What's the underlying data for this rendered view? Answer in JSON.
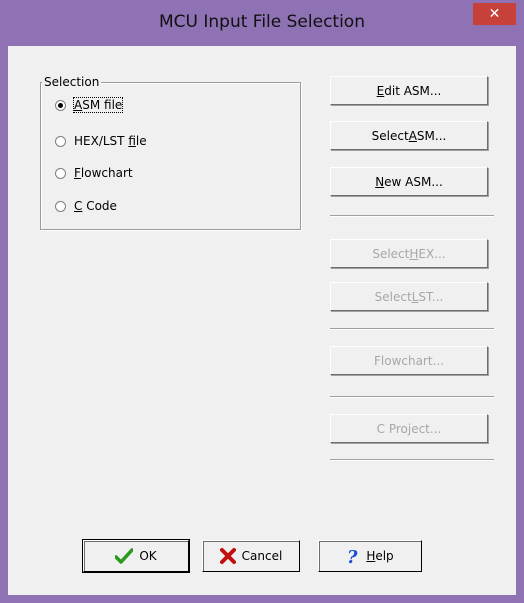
{
  "window": {
    "title": "MCU Input File Selection",
    "close_glyph": "✕"
  },
  "selection": {
    "legend": "Selection",
    "options": [
      {
        "label_u": "A",
        "label_rest": "SM file",
        "selected": true
      },
      {
        "label_pre": "HEX/LST ",
        "label_u": "f",
        "label_rest": "ile",
        "selected": false
      },
      {
        "label_u": "F",
        "label_rest": "lowchart",
        "selected": false
      },
      {
        "label_u": "C",
        "label_rest": " Code",
        "selected": false
      }
    ]
  },
  "buttons": {
    "edit_asm": {
      "u": "E",
      "rest": "dit ASM..."
    },
    "select_asm": {
      "pre": "Select ",
      "u": "A",
      "rest": "SM..."
    },
    "new_asm": {
      "u": "N",
      "rest": "ew ASM..."
    },
    "select_hex": {
      "pre": "Select ",
      "u": "H",
      "rest": "EX..."
    },
    "select_lst": {
      "pre": "Select ",
      "u": "L",
      "rest": "ST..."
    },
    "flowchart": {
      "label": "Flowchart..."
    },
    "c_project": {
      "label": "C Project..."
    }
  },
  "footer": {
    "ok": "OK",
    "cancel": "Cancel",
    "help_u": "H",
    "help_rest": "elp"
  },
  "colors": {
    "title_bar": "#8e72b4",
    "close": "#c7413a",
    "client": "#f0f0f0"
  }
}
